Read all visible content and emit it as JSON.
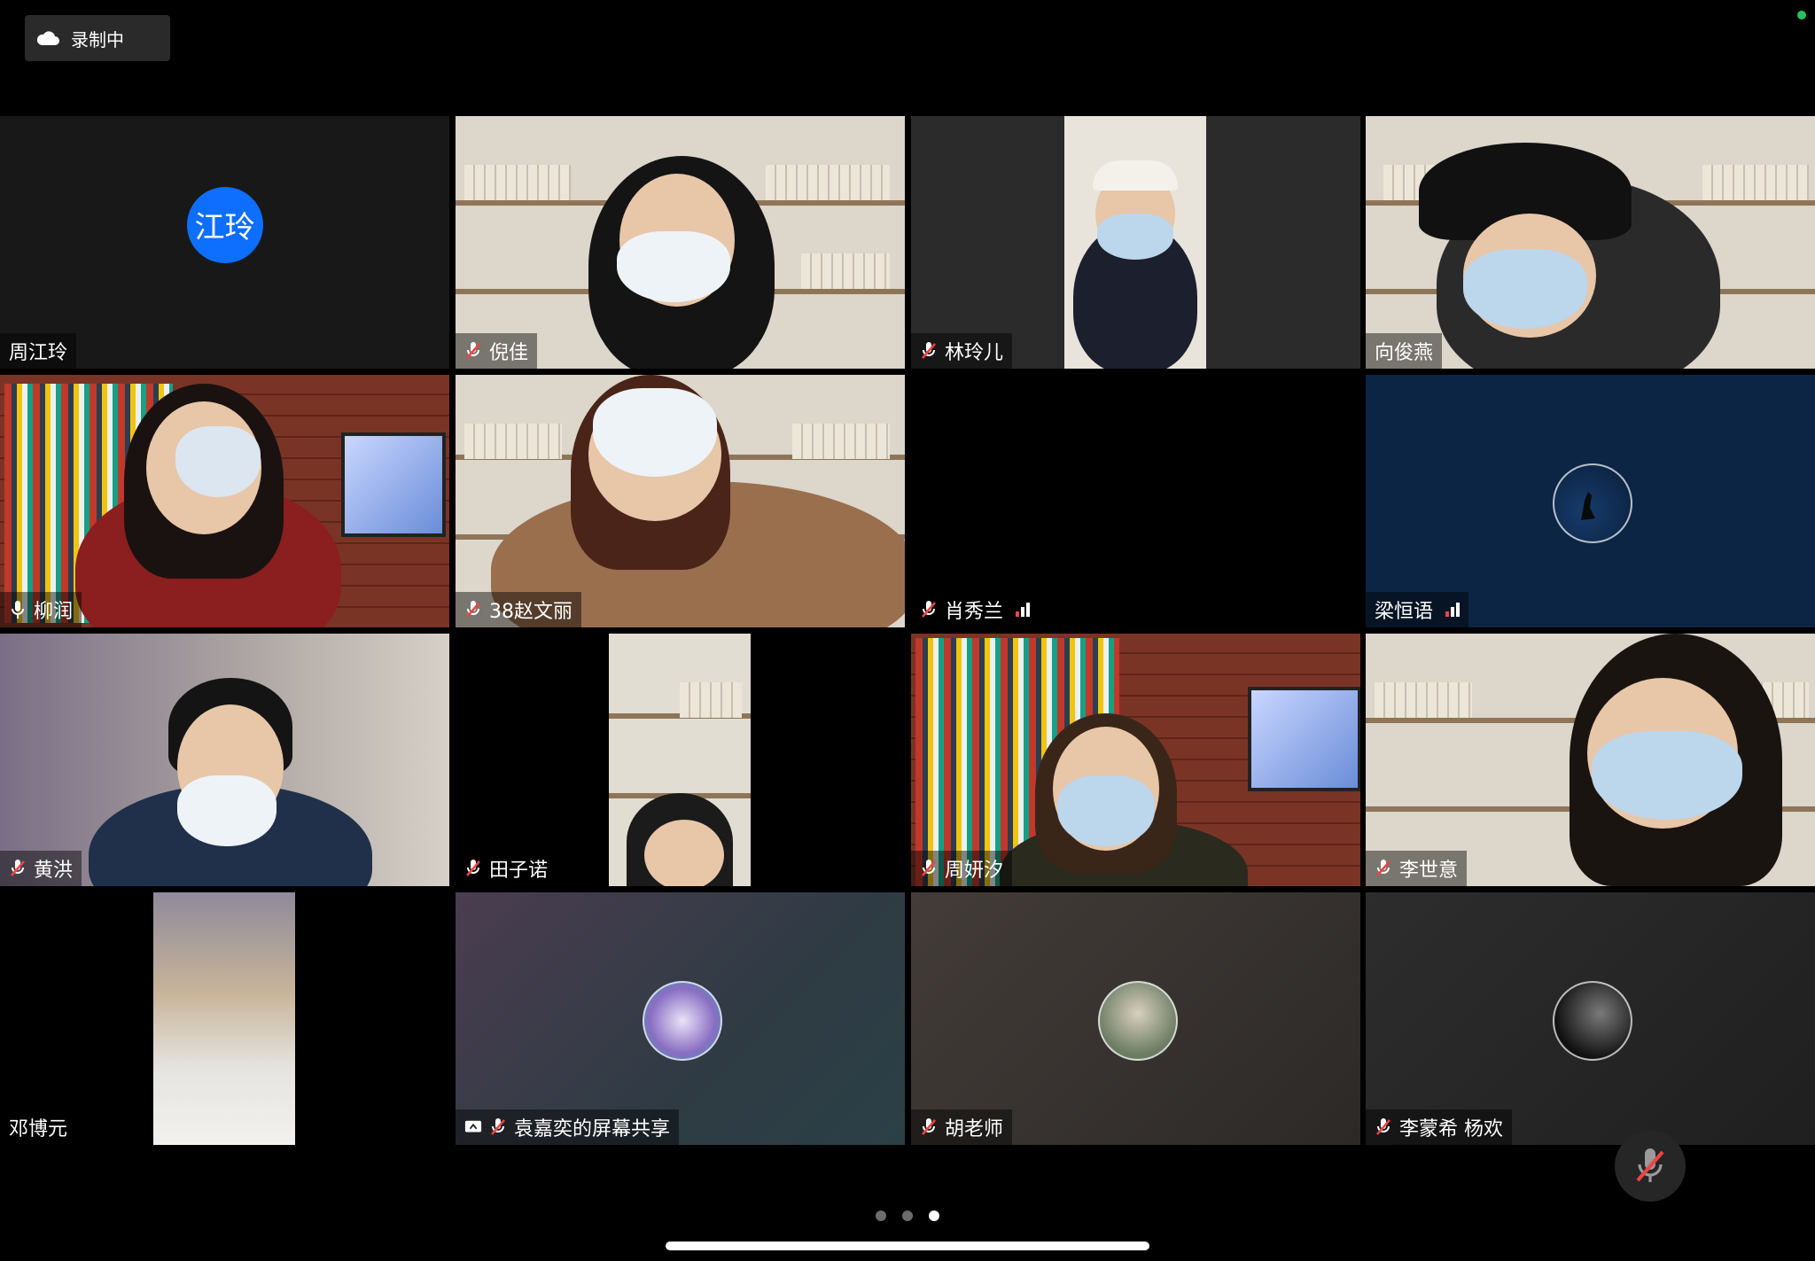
{
  "recording": {
    "label": "录制中"
  },
  "participants": [
    {
      "name": "周江玲",
      "avatar_text": "江玲",
      "mic": "none"
    },
    {
      "name": "倪佳",
      "mic": "muted"
    },
    {
      "name": "林玲儿",
      "mic": "muted"
    },
    {
      "name": "向俊燕",
      "mic": "none"
    },
    {
      "name": "柳润",
      "mic": "active",
      "speaking": true
    },
    {
      "name": "38赵文丽",
      "mic": "muted"
    },
    {
      "name": "肖秀兰",
      "mic": "muted",
      "signal": "weak"
    },
    {
      "name": "梁恒语",
      "mic": "none",
      "signal": "weak"
    },
    {
      "name": "黄洪",
      "mic": "muted"
    },
    {
      "name": "田子诺",
      "mic": "muted"
    },
    {
      "name": "周妍汐",
      "mic": "muted"
    },
    {
      "name": "李世意",
      "mic": "muted"
    },
    {
      "name": "邓博元",
      "mic": "none"
    },
    {
      "name": "袁嘉奕的屏幕共享",
      "mic": "muted",
      "screen_share": true
    },
    {
      "name": "胡老师",
      "mic": "muted"
    },
    {
      "name": "李蒙希 杨欢",
      "mic": "muted"
    }
  ],
  "pager": {
    "pages": 3,
    "current": 3
  },
  "colors": {
    "active_speaker": "#22c55e",
    "avatar_blue": "#0e6efd",
    "signal_red": "#ef4444"
  },
  "icons": {
    "recording": "cloud-icon",
    "muted": "mic-off-icon",
    "unmuted": "mic-icon",
    "share": "screen-share-icon"
  }
}
